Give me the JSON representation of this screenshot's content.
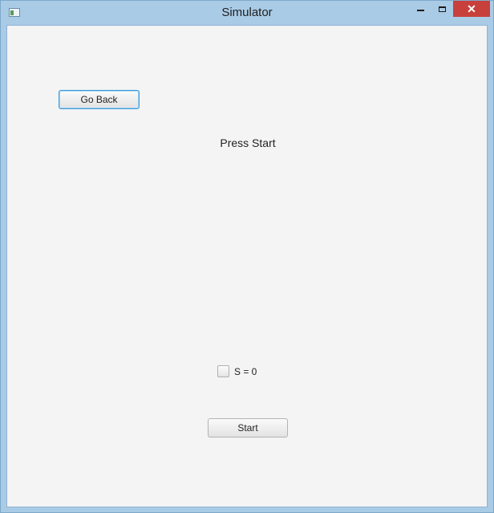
{
  "window": {
    "title": "Simulator",
    "controls": {
      "minimize_icon": "minimize-icon",
      "maximize_icon": "maximize-icon",
      "close_glyph": "✕"
    }
  },
  "main": {
    "go_back_label": "Go Back",
    "status_text": "Press Start",
    "checkbox": {
      "label": "S = 0",
      "checked": false
    },
    "start_label": "Start"
  },
  "colors": {
    "titlebar": "#a9cbe6",
    "close_button": "#c8403b",
    "client_background": "#f4f4f4",
    "focus_border": "#3d9bd9"
  }
}
